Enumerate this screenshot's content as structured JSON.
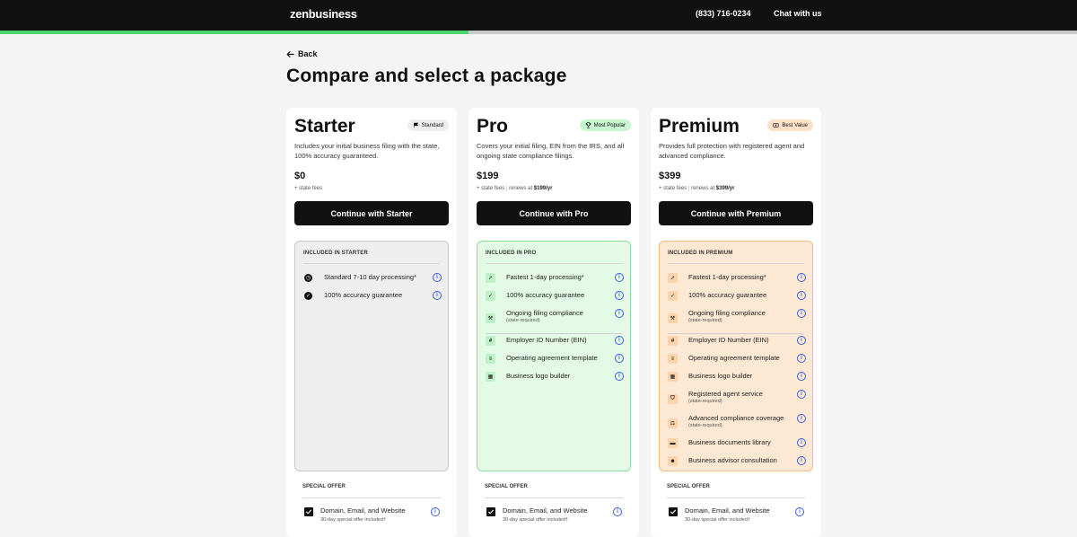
{
  "header": {
    "logo": "zenbusiness",
    "phone": "(833) 716-0234",
    "chat": "Chat with us",
    "progress_percent": 43.5
  },
  "nav": {
    "back_label": "Back"
  },
  "page": {
    "title": "Compare and select a package"
  },
  "colors": {
    "starter_panel": "#eeeeee",
    "pro_panel": "#e3fbe6",
    "premium_panel": "#fde8d3",
    "pro_badge": "#c7f6cf",
    "premium_badge": "#fde2c8",
    "pro_icon": "#bdf2c6",
    "premium_icon": "#fbd3ad",
    "info": "#3b5bdb"
  },
  "packages": [
    {
      "name": "Starter",
      "badge": "Standard",
      "badge_icon": "flag-icon",
      "description": "Includes your initial business filing with the state, 100% accuracy guaranteed.",
      "price": "$0",
      "fees": "+ state fees",
      "renewal_prefix": "",
      "renewal_price": "",
      "cta": "Continue with Starter",
      "included_heading": "INCLUDED IN STARTER",
      "features": [
        {
          "label": "Standard 7-10 day processing*",
          "sub": "",
          "icon": "clock-icon"
        },
        {
          "label": "100% accuracy guarantee",
          "sub": "",
          "icon": "check-badge-icon"
        }
      ],
      "special_heading": "SPECIAL OFFER",
      "offer_label": "Domain, Email, and Website",
      "offer_sub": "30-day special offer included†"
    },
    {
      "name": "Pro",
      "badge": "Most Popular",
      "badge_icon": "trophy-icon",
      "description": "Covers your initial filing, EIN from the IRS, and all ongoing state compliance filings.",
      "price": "$199",
      "fees": "+ state fees",
      "renewal_prefix": "renews at",
      "renewal_price": "$199/yr",
      "cta": "Continue with Pro",
      "included_heading": "INCLUDED IN PRO",
      "features": [
        {
          "label": "Fastest 1-day processing*",
          "sub": "",
          "icon": "rocket-icon"
        },
        {
          "label": "100% accuracy guarantee",
          "sub": "",
          "icon": "check-badge-icon"
        },
        {
          "label": "Ongoing filing compliance",
          "sub": "(state-required)",
          "icon": "gavel-icon"
        },
        {
          "label": "Employer ID Number (EIN)",
          "sub": "",
          "icon": "hash-icon"
        },
        {
          "label": "Operating agreement template",
          "sub": "",
          "icon": "document-icon"
        },
        {
          "label": "Business logo builder",
          "sub": "",
          "icon": "grid-icon"
        }
      ],
      "special_heading": "SPECIAL OFFER",
      "offer_label": "Domain, Email, and Website",
      "offer_sub": "30-day special offer included†"
    },
    {
      "name": "Premium",
      "badge": "Best Value",
      "badge_icon": "money-icon",
      "description": "Provides full protection with registered agent and advanced compliance.",
      "price": "$399",
      "fees": "+ state fees",
      "renewal_prefix": "renews at",
      "renewal_price": "$399/yr",
      "cta": "Continue with Premium",
      "included_heading": "INCLUDED IN PREMIUM",
      "features": [
        {
          "label": "Fastest 1-day processing*",
          "sub": "",
          "icon": "rocket-icon"
        },
        {
          "label": "100% accuracy guarantee",
          "sub": "",
          "icon": "check-badge-icon"
        },
        {
          "label": "Ongoing filing compliance",
          "sub": "(state-required)",
          "icon": "gavel-icon"
        },
        {
          "label": "Employer ID Number (EIN)",
          "sub": "",
          "icon": "hash-icon"
        },
        {
          "label": "Operating agreement template",
          "sub": "",
          "icon": "document-icon"
        },
        {
          "label": "Business logo builder",
          "sub": "",
          "icon": "grid-icon"
        },
        {
          "label": "Registered agent service",
          "sub": "(state-required)",
          "icon": "shield-icon"
        },
        {
          "label": "Advanced compliance coverage",
          "sub": "(state-required)",
          "icon": "scale-icon"
        },
        {
          "label": "Business documents library",
          "sub": "",
          "icon": "folder-icon"
        },
        {
          "label": "Business advisor consultation",
          "sub": "",
          "icon": "people-icon"
        }
      ],
      "special_heading": "SPECIAL OFFER",
      "offer_label": "Domain, Email, and Website",
      "offer_sub": "30-day special offer included†"
    }
  ]
}
